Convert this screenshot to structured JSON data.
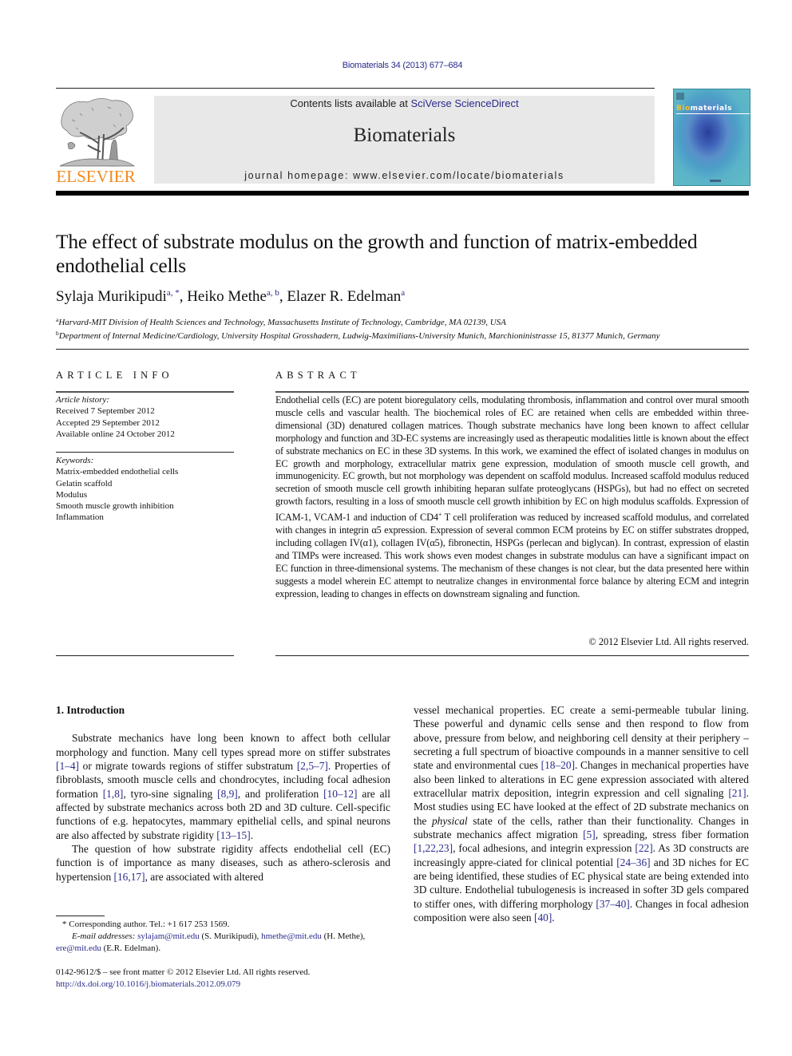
{
  "header": {
    "running_head": "Biomaterials 34 (2013) 677–684",
    "publisher_logo_text": "ELSEVIER",
    "contents_prefix": "Contents lists available at ",
    "contents_link": "SciVerse ScienceDirect",
    "journal_name": "Biomaterials",
    "homepage_prefix": "journal homepage: ",
    "homepage_url": "www.elsevier.com/locate/biomaterials",
    "cover_title_bio": "Bio",
    "cover_title_rest": "materials"
  },
  "colors": {
    "link": "#2a2a8c",
    "elsevier_orange": "#f08a1e",
    "banner_bg": "#e8e8e8",
    "cover_accent": "#f2c12e"
  },
  "article": {
    "title": "The effect of substrate modulus on the growth and function of matrix-embedded endothelial cells",
    "authors": [
      {
        "name": "Sylaja Murikipudi",
        "sup": "a, *",
        "sep": ", "
      },
      {
        "name": "Heiko Methe",
        "sup": "a, b",
        "sep": ", "
      },
      {
        "name": "Elazer R. Edelman",
        "sup": "a",
        "sep": ""
      }
    ],
    "affiliations": [
      {
        "key": "a",
        "text": "Harvard-MIT Division of Health Sciences and Technology, Massachusetts Institute of Technology, Cambridge, MA 02139, USA"
      },
      {
        "key": "b",
        "text": "Department of Internal Medicine/Cardiology, University Hospital Grosshadern, Ludwig-Maximilians-University Munich, Marchioninistrasse 15, 81377 Munich, Germany"
      }
    ]
  },
  "article_info": {
    "heading": "ARTICLE INFO",
    "history_label": "Article history:",
    "history": [
      "Received 7 September 2012",
      "Accepted 29 September 2012",
      "Available online 24 October 2012"
    ],
    "keywords_label": "Keywords:",
    "keywords": [
      "Matrix-embedded endothelial cells",
      "Gelatin scaffold",
      "Modulus",
      "Smooth muscle growth inhibition",
      "Inflammation"
    ]
  },
  "abstract": {
    "heading": "ABSTRACT",
    "text_1": "Endothelial cells (EC) are potent bioregulatory cells, modulating thrombosis, inflammation and control over mural smooth muscle cells and vascular health. The biochemical roles of EC are retained when cells are embedded within three-dimensional (3D) denatured collagen matrices. Though substrate mechanics have long been known to affect cellular morphology and function and 3D-EC systems are increasingly used as therapeutic modalities little is known about the effect of substrate mechanics on EC in these 3D systems. In this work, we examined the effect of isolated changes in modulus on EC growth and morphology, extracellular matrix gene expression, modulation of smooth muscle cell growth, and immunogenicity. EC growth, but not morphology was dependent on scaffold modulus. Increased scaffold modulus reduced secretion of smooth muscle cell growth inhibiting heparan sulfate proteoglycans (HSPGs), but had no effect on secreted growth factors, resulting in a loss of smooth muscle cell growth inhibition by EC on high modulus scaffolds. Expression of ICAM-1, VCAM-1 and induction of CD4",
    "sup_plus": "+",
    "text_2": " T cell proliferation was reduced by increased scaffold modulus, and correlated with changes in integrin α5 expression. Expression of several common ECM proteins by EC on stiffer substrates dropped, including collagen IV(α1), collagen IV(α5), fibronectin, HSPGs (perlecan and biglycan). In contrast, expression of elastin and TIMPs were increased. This work shows even modest changes in substrate modulus can have a significant impact on EC function in three-dimensional systems. The mechanism of these changes is not clear, but the data presented here within suggests a model wherein EC attempt to neutralize changes in environmental force balance by altering ECM and integrin expression, leading to changes in effects on downstream signaling and function.",
    "copyright": "© 2012 Elsevier Ltd. All rights reserved."
  },
  "body": {
    "section_heading": "1.  Introduction",
    "left_p1": [
      {
        "t": "Substrate mechanics have long been known to affect both cellular morphology and function. Many cell types spread more on stiffer substrates "
      },
      {
        "c": "[1–4]"
      },
      {
        "t": " or migrate towards regions of stiffer substratum "
      },
      {
        "c": "[2,5–7]"
      },
      {
        "t": ". Properties of fibroblasts, smooth muscle cells and chondrocytes, including focal adhesion formation "
      },
      {
        "c": "[1,8]"
      },
      {
        "t": ", tyro-sine signaling "
      },
      {
        "c": "[8,9]"
      },
      {
        "t": ", and proliferation "
      },
      {
        "c": "[10–12]"
      },
      {
        "t": " are all affected by substrate mechanics across both 2D and 3D culture. Cell-specific functions of e.g. hepatocytes, mammary epithelial cells, and spinal neurons are also affected by substrate rigidity "
      },
      {
        "c": "[13–15]"
      },
      {
        "t": "."
      }
    ],
    "left_p2": [
      {
        "t": "The question of how substrate rigidity affects endothelial cell (EC) function is of importance as many diseases, such as athero-sclerosis and hypertension "
      },
      {
        "c": "[16,17]"
      },
      {
        "t": ", are associated with altered"
      }
    ],
    "right_p1": [
      {
        "t": "vessel mechanical properties. EC create a semi-permeable tubular lining. These powerful and dynamic cells sense and then respond to flow from above, pressure from below, and neighboring cell density at their periphery – secreting a full spectrum of bioactive compounds in a manner sensitive to cell state and environmental cues "
      },
      {
        "c": "[18–20]"
      },
      {
        "t": ". Changes in mechanical properties have also been linked to alterations in EC gene expression associated with altered extracellular matrix deposition, integrin expression and cell signaling "
      },
      {
        "c": "[21]"
      },
      {
        "t": ". Most studies using EC have looked at the effect of 2D substrate mechanics on the "
      },
      {
        "i": "physical"
      },
      {
        "t": " state of the cells, rather than their functionality. Changes in substrate mechanics affect migration "
      },
      {
        "c": "[5]"
      },
      {
        "t": ", spreading, stress fiber formation "
      },
      {
        "c": "[1,22,23]"
      },
      {
        "t": ", focal adhesions, and integrin expression "
      },
      {
        "c": "[22]"
      },
      {
        "t": ". As 3D constructs are increasingly appre-ciated for clinical potential "
      },
      {
        "c": "[24–36]"
      },
      {
        "t": " and 3D niches for EC are being identified, these studies of EC physical state are being extended into 3D culture. Endothelial tubulogenesis is increased in softer 3D gels compared to stiffer ones, with differing morphology "
      },
      {
        "c": "[37–40]"
      },
      {
        "t": ". Changes in focal adhesion composition were also seen "
      },
      {
        "c": "[40]"
      },
      {
        "t": "."
      }
    ]
  },
  "footnotes": {
    "corresponding": "Corresponding author. Tel.: +1 617 253 1569.",
    "star": "*",
    "email_label": "E-mail addresses:",
    "emails": [
      {
        "addr": "sylajam@mit.edu",
        "who": " (S. Murikipudi), "
      },
      {
        "addr": "hmethe@mit.edu",
        "who": " (H. Methe),"
      },
      {
        "addr": "ere@mit.edu",
        "who": " (E.R. Edelman)."
      }
    ],
    "front_matter": "0142-9612/$ – see front matter © 2012 Elsevier Ltd. All rights reserved.",
    "doi": "http://dx.doi.org/10.1016/j.biomaterials.2012.09.079"
  }
}
